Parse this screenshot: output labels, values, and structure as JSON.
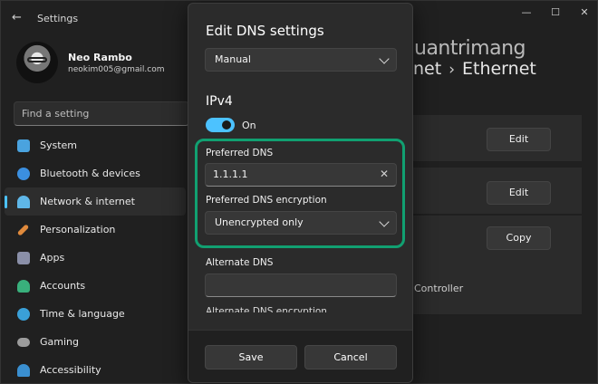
{
  "app": {
    "title": "Settings",
    "back_icon": "back-arrow-icon"
  },
  "window_controls": [
    {
      "name": "minimize-button",
      "glyph": "—"
    },
    {
      "name": "maximize-button",
      "glyph": "☐"
    },
    {
      "name": "close-button",
      "glyph": "✕"
    }
  ],
  "profile": {
    "name": "Neo Rambo",
    "email": "neokim005@gmail.com"
  },
  "search": {
    "placeholder": "Find a setting"
  },
  "sidebar": {
    "items": [
      {
        "label": "System",
        "color": "#4aa3df",
        "active": false
      },
      {
        "label": "Bluetooth & devices",
        "color": "#3b8fe0",
        "active": false
      },
      {
        "label": "Network & internet",
        "color": "#5fb7e8",
        "active": true
      },
      {
        "label": "Personalization",
        "color": "#e08a3c",
        "active": false
      },
      {
        "label": "Apps",
        "color": "#8a8fa8",
        "active": false
      },
      {
        "label": "Accounts",
        "color": "#39b07c",
        "active": false
      },
      {
        "label": "Time & language",
        "color": "#3aa0d8",
        "active": false
      },
      {
        "label": "Gaming",
        "color": "#9c9c9c",
        "active": false
      },
      {
        "label": "Accessibility",
        "color": "#3a8fd0",
        "active": false
      }
    ]
  },
  "breadcrumb": {
    "parent": "net",
    "separator": "›",
    "current": "Ethernet"
  },
  "watermark": {
    "text": "uantrimang"
  },
  "pane_buttons": {
    "edit_1": "Edit",
    "edit_2": "Edit",
    "copy": "Copy"
  },
  "pane_text": {
    "controller": "Controller"
  },
  "dialog": {
    "title": "Edit DNS settings",
    "mode_select": "Manual",
    "section": "IPv4",
    "toggle_label": "On",
    "toggle_on": true,
    "preferred_dns_label": "Preferred DNS",
    "preferred_dns_value": "1.1.1.1",
    "preferred_encryption_label": "Preferred DNS encryption",
    "preferred_encryption_value": "Unencrypted only",
    "alternate_dns_label": "Alternate DNS",
    "alternate_dns_value": "",
    "alternate_encryption_label": "Alternate DNS encryption",
    "save_label": "Save",
    "cancel_label": "Cancel"
  },
  "colors": {
    "accent": "#4cc2ff",
    "highlight": "#11a071"
  }
}
